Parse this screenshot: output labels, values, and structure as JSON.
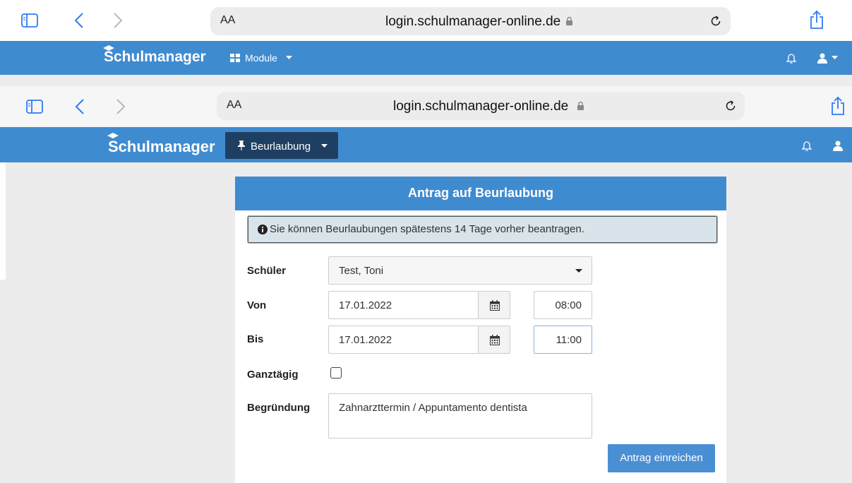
{
  "browser": {
    "reader_aa": "AA",
    "url": "login.schulmanager-online.de"
  },
  "app": {
    "brand": "Schulmanager",
    "menu_modules": "Module",
    "menu_beurlaubung": "Beurlaubung"
  },
  "form": {
    "title": "Antrag auf Beurlaubung",
    "info": "Sie können Beurlaubungen spätestens 14 Tage vorher beantragen.",
    "student_label": "Schüler",
    "student_value": "Test, Toni",
    "from_label": "Von",
    "from_date": "17.01.2022",
    "from_time": "08:00",
    "to_label": "Bis",
    "to_date": "17.01.2022",
    "to_time": "11:00",
    "allday_label": "Ganztägig",
    "reason_label": "Begründung",
    "reason_value": "Zahnarzttermin / Appuntamento dentista",
    "submit_label": "Antrag einreichen"
  },
  "colors": {
    "navbar": "#3f8bd0",
    "active_menu": "#1f3f62",
    "submit": "#4a8fd4"
  }
}
